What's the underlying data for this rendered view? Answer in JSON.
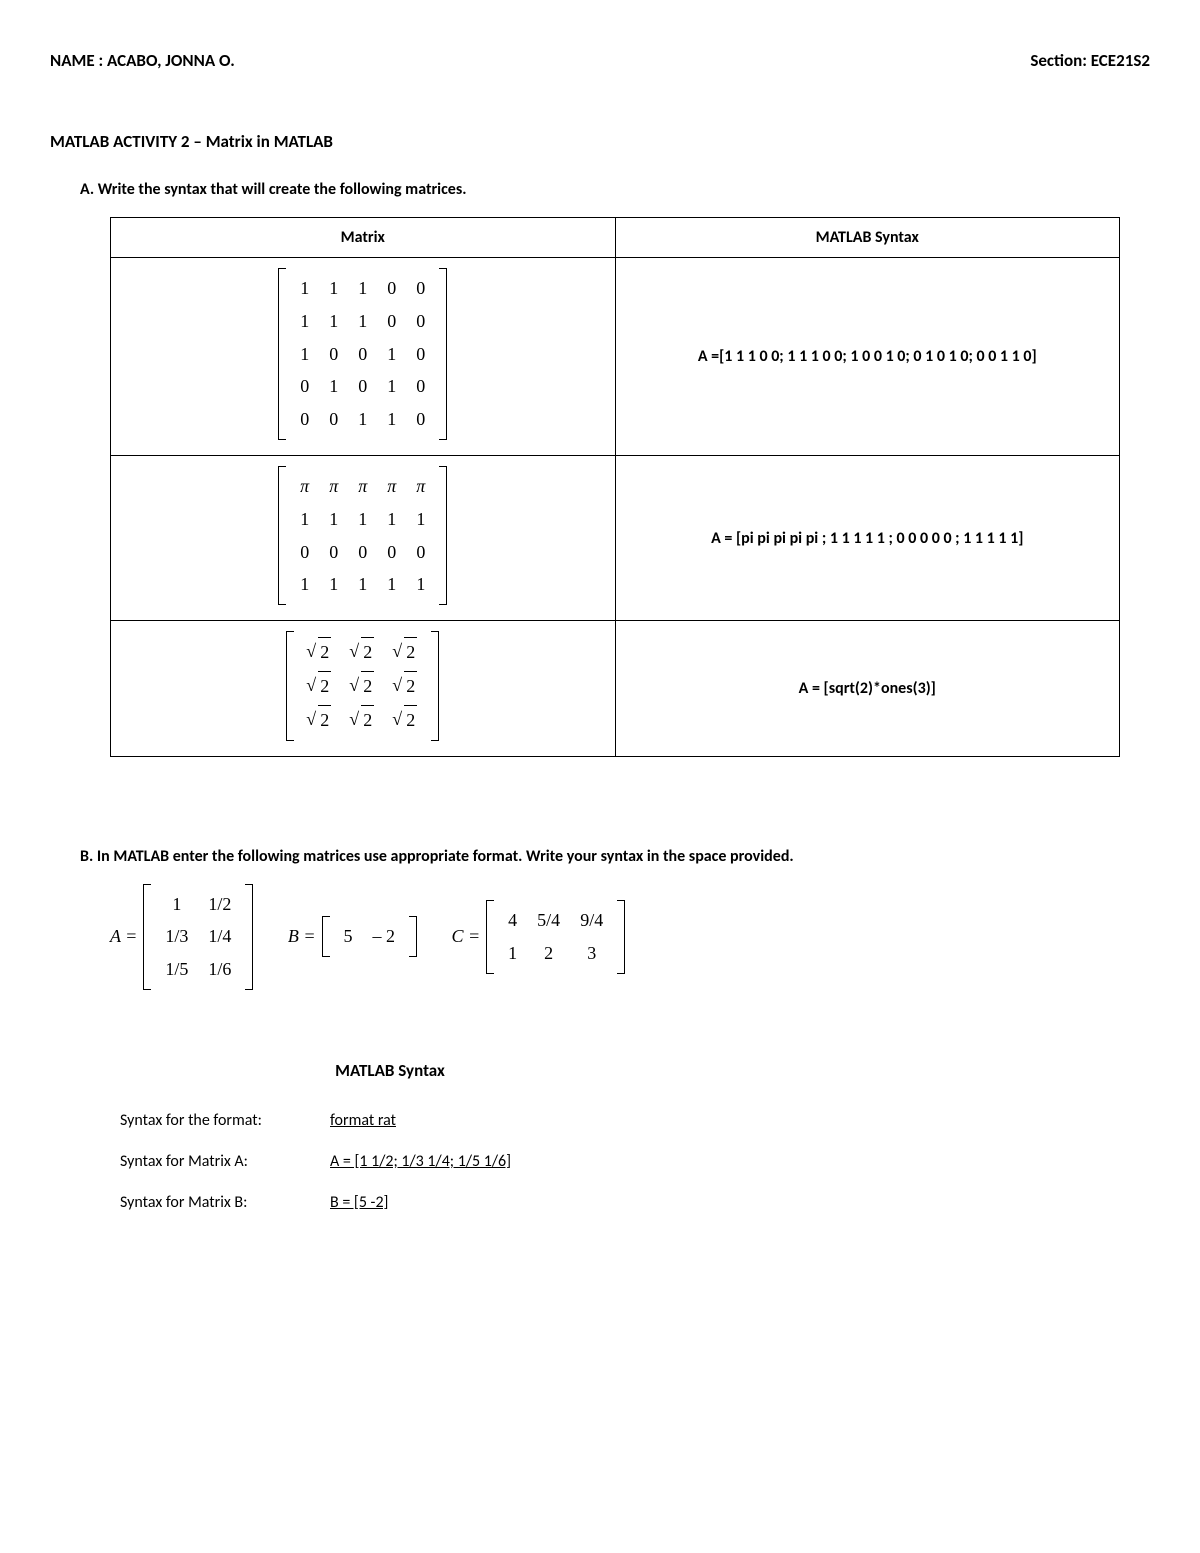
{
  "header": {
    "name_label": "NAME : ACABO, JONNA O.",
    "section_label": "Section: ECE21S2"
  },
  "activity_title": "MATLAB ACTIVITY  2 – Matrix in  MATLAB",
  "section_a": {
    "label": "A.   Write the syntax that will create the following matrices.",
    "col_matrix": "Matrix",
    "col_syntax": "MATLAB Syntax",
    "rows": [
      {
        "matrix": [
          [
            "1",
            "1",
            "1",
            "0",
            "0"
          ],
          [
            "1",
            "1",
            "1",
            "0",
            "0"
          ],
          [
            "1",
            "0",
            "0",
            "1",
            "0"
          ],
          [
            "0",
            "1",
            "0",
            "1",
            "0"
          ],
          [
            "0",
            "0",
            "1",
            "1",
            "0"
          ]
        ],
        "syntax": "A =[1 1 1 0 0; 1 1 1 0 0; 1 0 0 1 0; 0 1 0 1 0; 0 0 1 1 0]"
      },
      {
        "matrix": [
          [
            "π",
            "π",
            "π",
            "π",
            "π"
          ],
          [
            "1",
            "1",
            "1",
            "1",
            "1"
          ],
          [
            "0",
            "0",
            "0",
            "0",
            "0"
          ],
          [
            "1",
            "1",
            "1",
            "1",
            "1"
          ]
        ],
        "syntax": "A = [pi pi pi pi pi ; 1 1 1 1 1 ; 0 0 0 0 0 ; 1 1 1 1 1]"
      },
      {
        "matrix": [
          [
            "√2",
            "√2",
            "√2"
          ],
          [
            "√2",
            "√2",
            "√2"
          ],
          [
            "√2",
            "√2",
            "√2"
          ]
        ],
        "syntax": "A = [sqrt(2)*ones(3)]"
      }
    ]
  },
  "section_b": {
    "label": "B.   In MATLAB enter the following matrices use appropriate format. Write your syntax in the space provided.",
    "defs": {
      "A_label": "A =",
      "A": [
        [
          "1",
          "1/2"
        ],
        [
          "1/3",
          "1/4"
        ],
        [
          "1/5",
          "1/6"
        ]
      ],
      "B_label": "B =",
      "B": [
        [
          "5",
          "– 2"
        ]
      ],
      "C_label": "C =",
      "C": [
        [
          "4",
          "5/4",
          "9/4"
        ],
        [
          "1",
          "2",
          "3"
        ]
      ]
    },
    "syntax_heading": "MATLAB Syntax",
    "lines": [
      {
        "k": "Syntax for the format:",
        "v": "format rat"
      },
      {
        "k": "Syntax for Matrix A:",
        "v": "A = [1 1/2; 1/3 1/4; 1/5 1/6]"
      },
      {
        "k": "Syntax for Matrix B:",
        "v": "B = [5 -2]"
      }
    ]
  }
}
